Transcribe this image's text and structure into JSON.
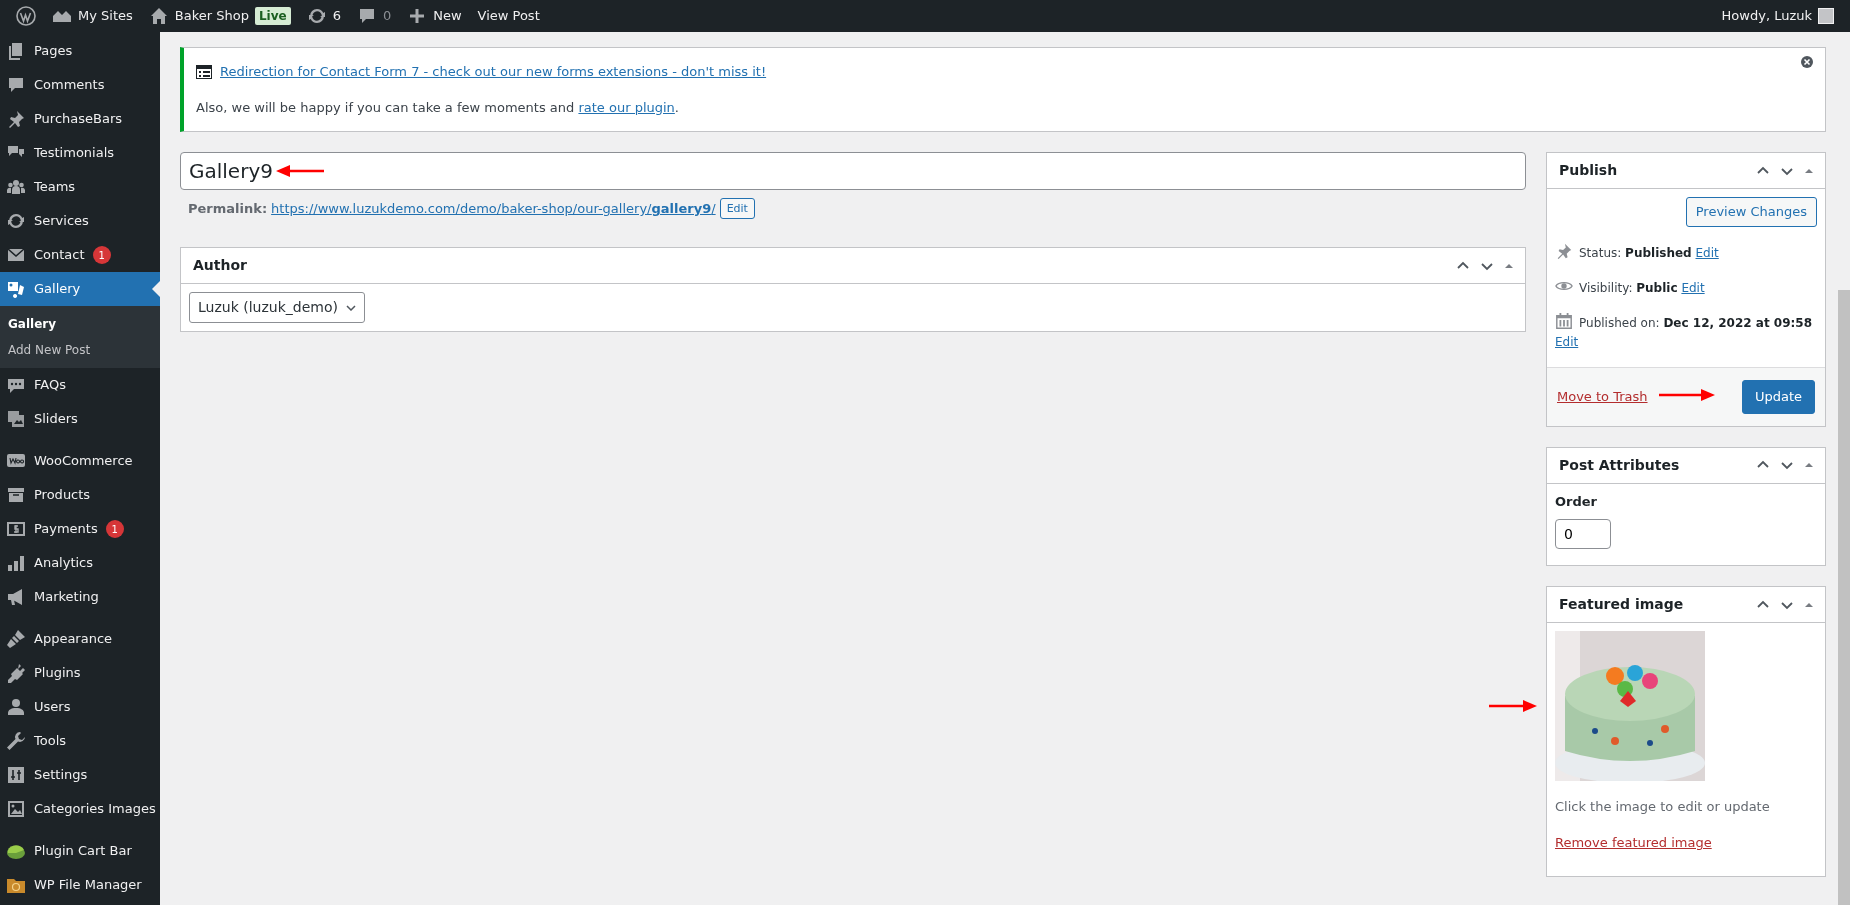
{
  "admin_bar": {
    "items": [
      {
        "label": "My Sites"
      },
      {
        "label": "Baker Shop",
        "badge": "Live"
      },
      {
        "label": "6"
      },
      {
        "label": "0"
      },
      {
        "label": "New"
      },
      {
        "label": "View Post"
      }
    ],
    "account": "Howdy, Luzuk"
  },
  "sidebar": {
    "groups": [
      [
        {
          "label": "Pages",
          "selected": false
        },
        {
          "label": "Comments",
          "selected": false
        },
        {
          "label": "PurchaseBars",
          "selected": false
        },
        {
          "label": "Testimonials",
          "selected": false
        },
        {
          "label": "Teams",
          "selected": false
        },
        {
          "label": "Services",
          "selected": false
        },
        {
          "label": "Contact",
          "badge": "1",
          "selected": false
        },
        {
          "label": "Gallery",
          "selected": true,
          "children": [
            {
              "label": "Gallery",
              "selected": true
            },
            {
              "label": "Add New Post",
              "selected": false
            }
          ]
        },
        {
          "label": "FAQs",
          "selected": false
        },
        {
          "label": "Sliders",
          "selected": false
        }
      ],
      [
        {
          "label": "WooCommerce",
          "selected": false
        },
        {
          "label": "Products",
          "selected": false
        },
        {
          "label": "Payments",
          "badge": "1",
          "selected": false
        },
        {
          "label": "Analytics",
          "selected": false
        },
        {
          "label": "Marketing",
          "selected": false
        }
      ],
      [
        {
          "label": "Appearance",
          "selected": false
        },
        {
          "label": "Plugins",
          "selected": false
        },
        {
          "label": "Users",
          "selected": false
        },
        {
          "label": "Tools",
          "selected": false
        },
        {
          "label": "Settings",
          "selected": false
        },
        {
          "label": "Categories Images",
          "selected": false
        }
      ],
      [
        {
          "label": "Plugin Cart Bar",
          "selected": false
        },
        {
          "label": "WP File Manager",
          "selected": false
        }
      ]
    ]
  },
  "notice": {
    "link": "Redirection for Contact Form 7 - check out our new forms extensions - don't miss it!",
    "text": "Also, we will be happy if you can take a few moments and ",
    "text_link": "rate our plugin",
    "text_end": "."
  },
  "title": {
    "value": "Gallery9"
  },
  "permalink": {
    "label": "Permalink:",
    "url": "https://www.luzukdemo.com/demo/baker-shop/our-gallery/**gallery9**/",
    "button": "Edit"
  },
  "author": {
    "title": "Author",
    "value": "Luzuk (luzuk_demo)"
  },
  "publish": {
    "title": "Publish",
    "preview": "Preview Changes",
    "rows": [
      {
        "label": "Status: ",
        "value": "Published",
        "link": "Edit"
      },
      {
        "label": "Visibility: ",
        "value": "Public",
        "link": "Edit"
      },
      {
        "label": "Published on: ",
        "value": "Dec 12, 2022 at 09:58",
        "link": "Edit"
      }
    ],
    "trash": "Move to Trash",
    "update": "Update"
  },
  "attributes": {
    "title": "Post Attributes",
    "label": "Order",
    "value": "0"
  },
  "featured": {
    "title": "Featured image",
    "hint": "Click the image to edit or update",
    "remove": "Remove featured image"
  }
}
